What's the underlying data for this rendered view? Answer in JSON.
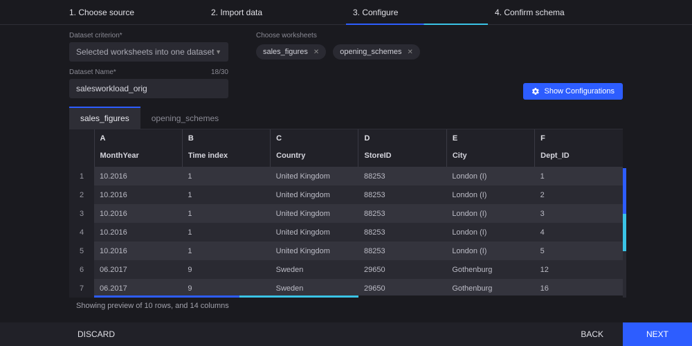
{
  "stepper": {
    "steps": [
      {
        "label": "1. Choose source"
      },
      {
        "label": "2. Import data"
      },
      {
        "label": "3. Configure"
      },
      {
        "label": "4. Confirm schema"
      }
    ],
    "activeIndex": 2
  },
  "criterion": {
    "label": "Dataset criterion*",
    "value": "Selected worksheets into one dataset"
  },
  "worksheets": {
    "label": "Choose worksheets",
    "chips": [
      "sales_figures",
      "opening_schemes"
    ]
  },
  "datasetName": {
    "label": "Dataset Name*",
    "counter": "18/30",
    "value": "salesworkload_orig"
  },
  "showConfigBtn": "Show Configurations",
  "tabs": {
    "items": [
      "sales_figures",
      "opening_schemes"
    ],
    "activeIndex": 0
  },
  "table": {
    "colLetters": [
      "A",
      "B",
      "C",
      "D",
      "E",
      "F"
    ],
    "headers": [
      "MonthYear",
      "Time index",
      "Country",
      "StoreID",
      "City",
      "Dept_ID"
    ],
    "rows": [
      [
        "10.2016",
        "1",
        "United Kingdom",
        "88253",
        "London (I)",
        "1"
      ],
      [
        "10.2016",
        "1",
        "United Kingdom",
        "88253",
        "London (I)",
        "2"
      ],
      [
        "10.2016",
        "1",
        "United Kingdom",
        "88253",
        "London (I)",
        "3"
      ],
      [
        "10.2016",
        "1",
        "United Kingdom",
        "88253",
        "London (I)",
        "4"
      ],
      [
        "10.2016",
        "1",
        "United Kingdom",
        "88253",
        "London (I)",
        "5"
      ],
      [
        "06.2017",
        "9",
        "Sweden",
        "29650",
        "Gothenburg",
        "12"
      ],
      [
        "06.2017",
        "9",
        "Sweden",
        "29650",
        "Gothenburg",
        "16"
      ]
    ]
  },
  "previewNote": "Showing preview of 10 rows, and 14 columns",
  "footer": {
    "discard": "DISCARD",
    "back": "BACK",
    "next": "NEXT"
  }
}
